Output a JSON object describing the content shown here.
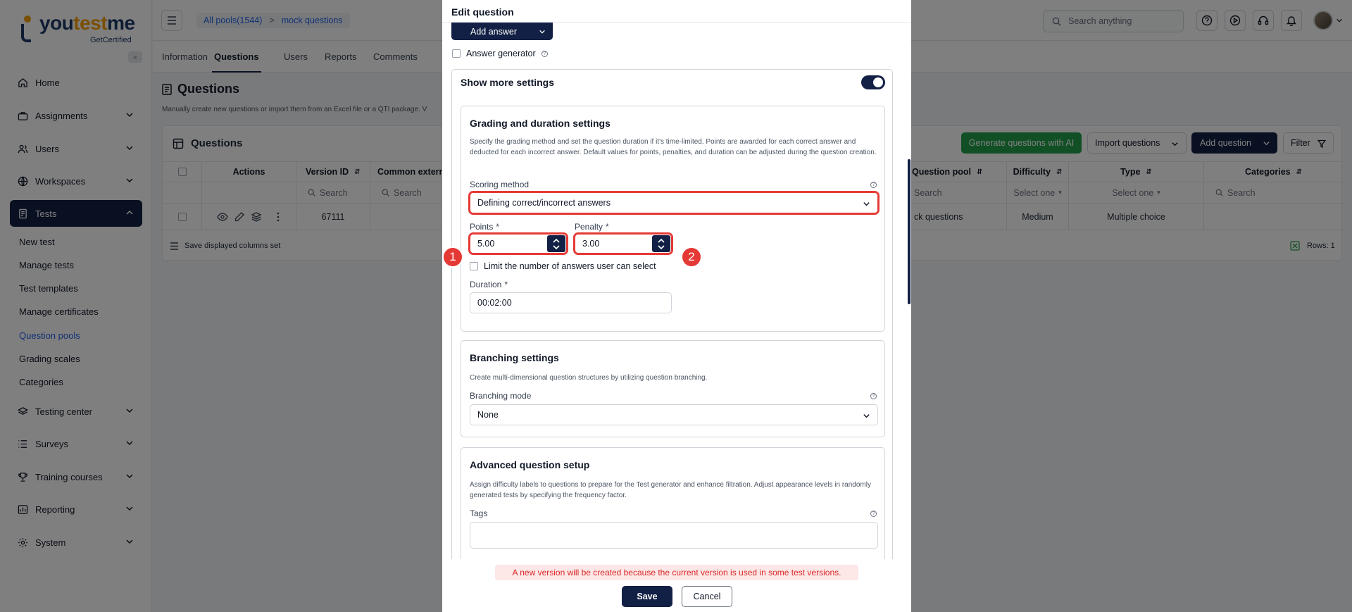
{
  "brand": {
    "name_part1": "you",
    "name_part2": "test",
    "name_part3": "me",
    "sub": "GetCertified",
    "accent": "#f59e0b",
    "primary": "#132045"
  },
  "sidebar": {
    "items": [
      {
        "label": "Home",
        "icon": "home-icon"
      },
      {
        "label": "Assignments",
        "icon": "briefcase-icon"
      },
      {
        "label": "Users",
        "icon": "users-icon"
      },
      {
        "label": "Workspaces",
        "icon": "globe-icon"
      },
      {
        "label": "Tests",
        "icon": "document-icon"
      },
      {
        "label": "Testing center",
        "icon": "layers-icon"
      },
      {
        "label": "Surveys",
        "icon": "list-icon"
      },
      {
        "label": "Training courses",
        "icon": "trophy-icon"
      },
      {
        "label": "Reporting",
        "icon": "chart-icon"
      },
      {
        "label": "System",
        "icon": "gear-icon"
      }
    ],
    "tests_sub": [
      "New test",
      "Manage tests",
      "Test templates",
      "Manage certificates",
      "Question pools",
      "Grading scales",
      "Categories"
    ]
  },
  "topbar": {
    "breadcrumb": [
      "All pools(1544)",
      "mock questions"
    ],
    "search_placeholder": "Search anything"
  },
  "tabs": [
    "Information",
    "Questions",
    "Users",
    "Reports",
    "Comments"
  ],
  "page": {
    "title": "Questions",
    "description": "Manually create new questions or import them from an Excel file or a QTI package. V"
  },
  "panel": {
    "title": "Questions",
    "btn_generate": "Generate questions with AI",
    "btn_import": "Import questions",
    "btn_add": "Add question",
    "btn_filter": "Filter",
    "columns": [
      "Actions",
      "Version ID",
      "Common externa",
      "Question pool",
      "Difficulty",
      "Type",
      "Categories"
    ],
    "filters": {
      "search": "Search",
      "select": "Select one"
    },
    "row": {
      "version_id": "67111",
      "pool": "ck questions",
      "difficulty": "Medium",
      "type": "Multiple choice"
    },
    "footer_left": "Save displayed columns set",
    "footer_right": "Rows: 1"
  },
  "modal": {
    "title": "Edit question",
    "add_answer": "Add answer",
    "answer_generator": "Answer generator",
    "show_more": "Show more settings",
    "grading": {
      "title": "Grading and duration settings",
      "desc": "Specify the grading method and set the question duration if it's time-limited. Points are awarded for each correct answer and deducted for each incorrect answer. Default values for points, penalties, and duration can be adjusted during the question creation.",
      "scoring_label": "Scoring method",
      "scoring_value": "Defining correct/incorrect answers",
      "points_label": "Points",
      "points_value": "5.00",
      "penalty_label": "Penalty",
      "penalty_value": "3.00",
      "limit_label": "Limit the number of answers user can select",
      "duration_label": "Duration",
      "duration_value": "00:02:00",
      "req": "*"
    },
    "branching": {
      "title": "Branching settings",
      "desc": "Create multi-dimensional question structures by utilizing question branching.",
      "mode_label": "Branching mode",
      "mode_value": "None"
    },
    "advanced": {
      "title": "Advanced question setup",
      "desc": "Assign difficulty labels to questions to prepare for the Test generator and enhance filtration. Adjust appearance levels in randomly generated tests by specifying the frequency factor.",
      "tags_label": "Tags"
    },
    "warning": "A new version will be created because the current version is used in some test versions.",
    "save": "Save",
    "cancel": "Cancel",
    "annotations": [
      "1",
      "2"
    ]
  }
}
